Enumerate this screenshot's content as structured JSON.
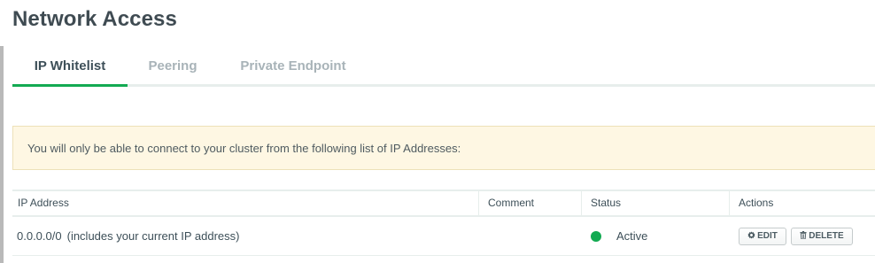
{
  "page": {
    "title": "Network Access"
  },
  "tabs": [
    {
      "label": "IP Whitelist",
      "active": true
    },
    {
      "label": "Peering",
      "active": false
    },
    {
      "label": "Private Endpoint",
      "active": false
    }
  ],
  "notice": {
    "text": "You will only be able to connect to your cluster from the following list of IP Addresses:"
  },
  "table": {
    "headers": {
      "ip": "IP Address",
      "comment": "Comment",
      "status": "Status",
      "actions": "Actions"
    },
    "rows": [
      {
        "ip": "0.0.0.0/0",
        "note": "(includes your current IP address)",
        "comment": "",
        "status": "Active",
        "edit_label": "EDIT",
        "delete_label": "DELETE"
      }
    ]
  },
  "colors": {
    "accent_green": "#13aa52",
    "notice_bg": "#fef7e3"
  },
  "icons": {
    "edit": "gear-icon",
    "delete": "trash-icon",
    "status": "status-dot-icon"
  }
}
